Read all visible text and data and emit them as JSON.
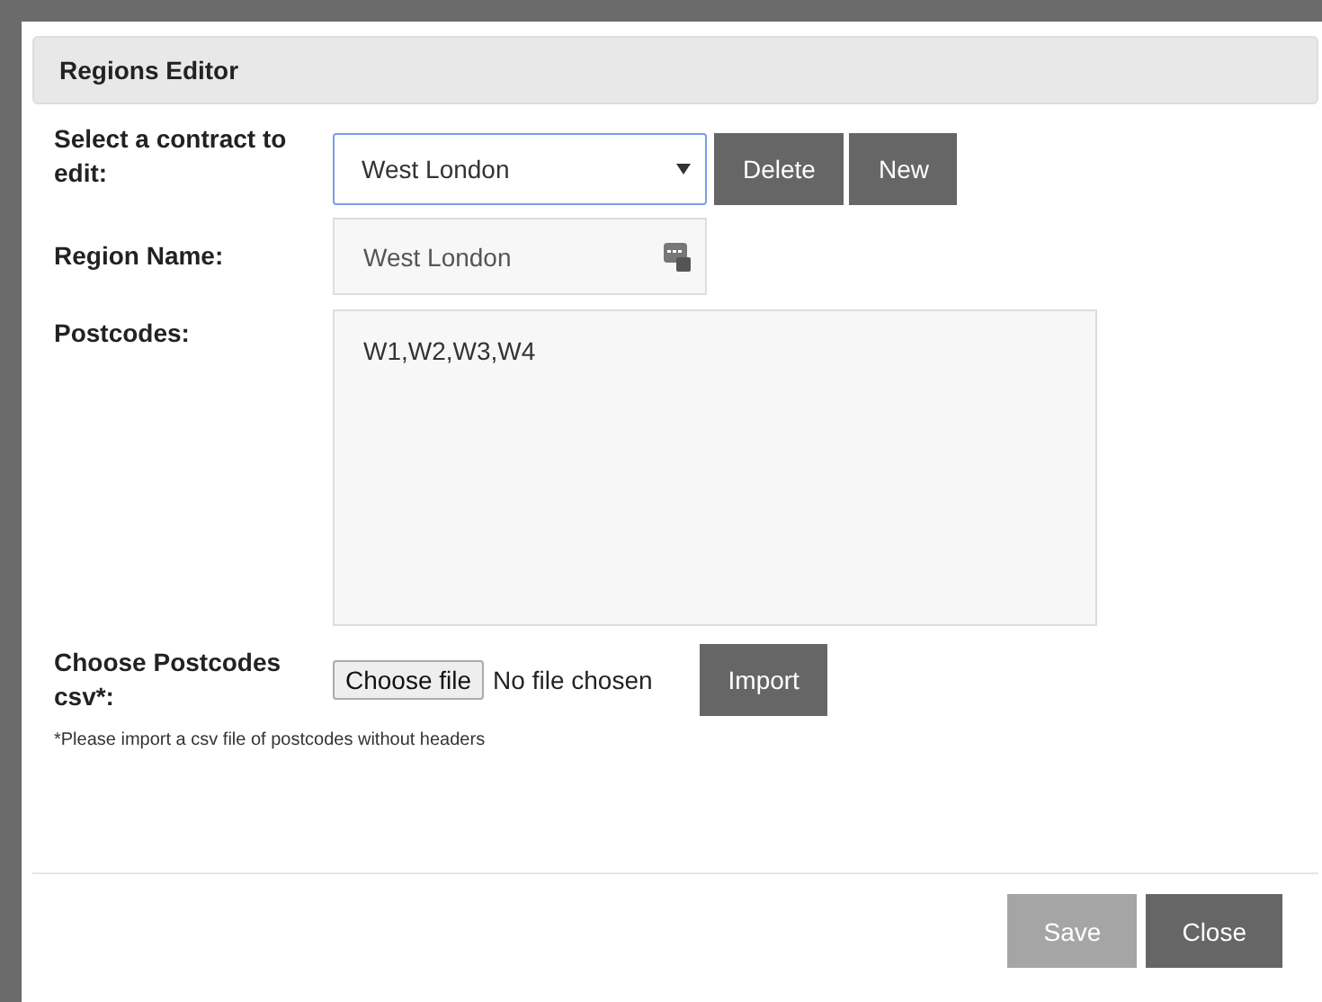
{
  "dialog": {
    "title": "Regions Editor"
  },
  "contract": {
    "label": "Select a contract to edit:",
    "value": "West London",
    "buttons": [
      {
        "label": "Delete"
      },
      {
        "label": "New"
      }
    ]
  },
  "region_name": {
    "label": "Region Name:",
    "value": "West London"
  },
  "postcodes": {
    "label": "Postcodes:",
    "value": "W1,W2,W3,W4"
  },
  "csv": {
    "label": "Choose Postcodes csv*:",
    "choose_button": "Choose file",
    "file_status": "No file chosen",
    "import_button": "Import",
    "note": "*Please import a csv file of postcodes without headers"
  },
  "footer_buttons": [
    {
      "label": "Save",
      "disabled": true
    },
    {
      "label": "Close",
      "disabled": false
    }
  ]
}
